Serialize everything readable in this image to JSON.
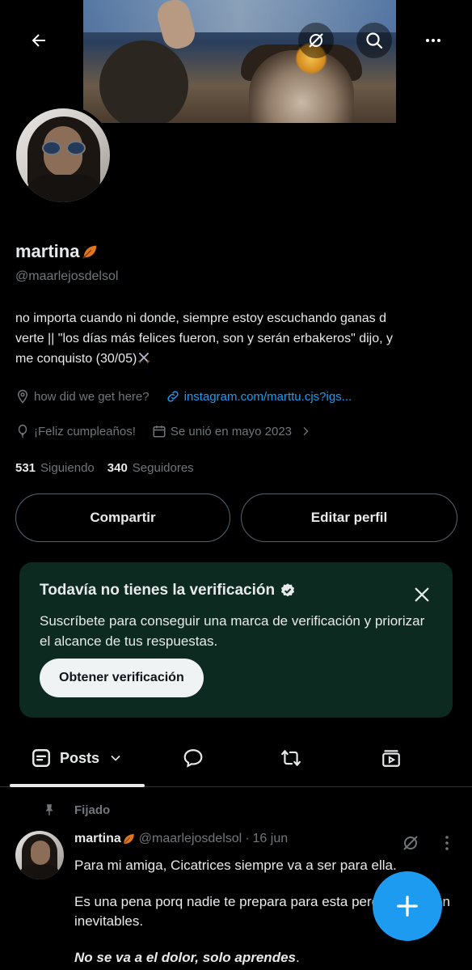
{
  "profile": {
    "name": "martina",
    "handle": "@maarlejosdelsol",
    "bio_line1": "no importa cuando ni donde, siempre estoy escuchando ganas d",
    "bio_line2": "verte || \"los días más felices fueron, son y serán erbakeros\" dijo, y",
    "bio_line3": "me conquisto (30/05)",
    "location": "how did we get here?",
    "website": "instagram.com/marttu.cjs?igs...",
    "birthday": "¡Feliz cumpleaños!",
    "joined": "Se unió en mayo 2023",
    "following_count": "531",
    "following_label": "Siguiendo",
    "followers_count": "340",
    "followers_label": "Seguidores"
  },
  "actions": {
    "share_label": "Compartir",
    "edit_label": "Editar perfil"
  },
  "verification": {
    "title": "Todavía no tienes la verificación",
    "description": "Suscríbete para conseguir una marca de verificación y priorizar el alcance de tus respuestas.",
    "cta_label": "Obtener verificación"
  },
  "tabs": {
    "posts_label": "Posts"
  },
  "pinned_post": {
    "pinned_label": "Fijado",
    "author_name": "martina",
    "author_handle": "@maarlejosdelsol",
    "separator": "·",
    "date": "16 jun",
    "paragraph1": "Para mi amiga, Cicatrices siempre va a ser para ella.",
    "paragraph2": "Es una pena porq nadie te prepara para esta pero pasan, son inevitables.",
    "paragraph3_em": "No se va a el dolor, solo aprendes",
    "paragraph3_end": "."
  },
  "colors": {
    "accent": "#1d9bf0",
    "background": "#000000",
    "muted_text": "#71767b",
    "verify_card_bg": "#0c2a20"
  },
  "icons": [
    "back-arrow-icon",
    "grok-icon",
    "search-icon",
    "more-icon",
    "location-icon",
    "link-icon",
    "balloon-icon",
    "calendar-icon",
    "chevron-right-icon",
    "verified-badge-icon",
    "close-icon",
    "posts-icon",
    "chevron-down-icon",
    "replies-icon",
    "reposts-icon",
    "media-icon",
    "pin-icon",
    "plus-icon"
  ]
}
